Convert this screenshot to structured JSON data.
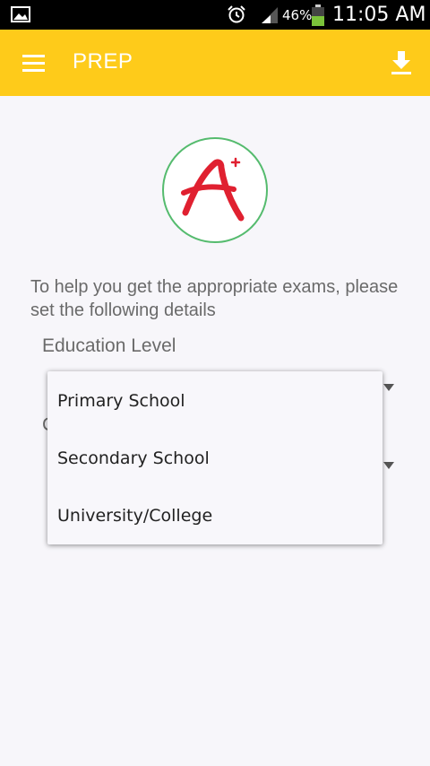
{
  "status_bar": {
    "battery_percent": "46%",
    "time": "11:05 AM",
    "icons": [
      "image-icon",
      "alarm-icon",
      "signal-icon",
      "battery-icon"
    ]
  },
  "app_bar": {
    "title": "PREP",
    "icons": [
      "menu-icon",
      "download-icon"
    ],
    "color": "#fecb1a"
  },
  "logo": {
    "letter": "A",
    "superscript": "+",
    "ring_color": "#55bb6e",
    "letter_color": "#e02030"
  },
  "intro": {
    "text": "To help you get the appropriate exams, please set the following details"
  },
  "form": {
    "education_label": "Education Level",
    "second_label_partial": "C",
    "dropdown_options": [
      "Primary School",
      "Secondary School",
      "University/College"
    ]
  }
}
